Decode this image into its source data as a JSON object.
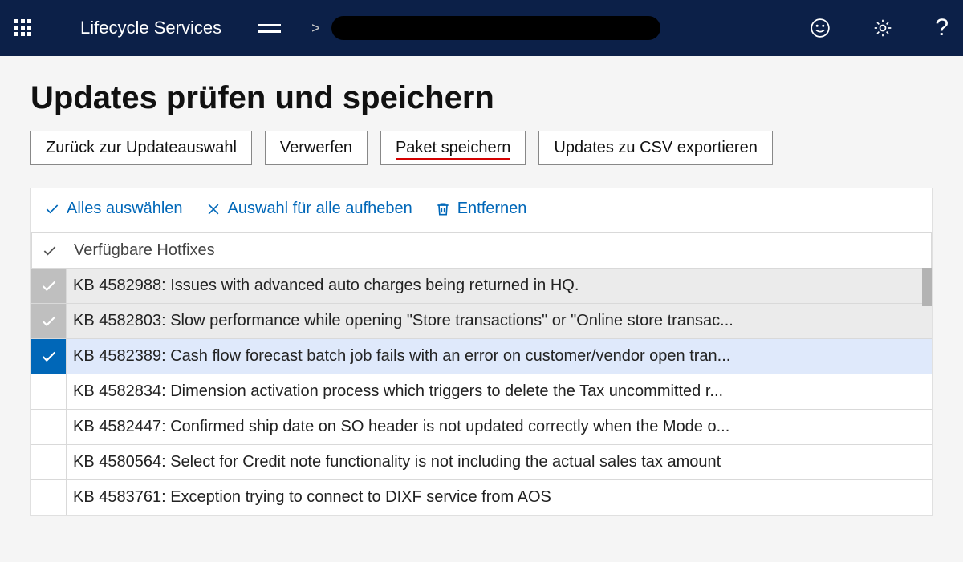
{
  "header": {
    "brand": "Lifecycle Services",
    "breadcrumb_chevron": ">"
  },
  "page": {
    "title": "Updates prüfen und speichern"
  },
  "buttons": {
    "back": "Zurück zur Updateauswahl",
    "discard": "Verwerfen",
    "save": "Paket speichern",
    "export": "Updates zu CSV exportieren"
  },
  "toolbar": {
    "select_all": "Alles auswählen",
    "deselect_all": "Auswahl für alle aufheben",
    "remove": "Entfernen"
  },
  "grid": {
    "header": "Verfügbare Hotfixes",
    "rows": [
      {
        "selected": true,
        "active": false,
        "text": "KB 4582988: Issues with advanced auto charges being returned in HQ."
      },
      {
        "selected": true,
        "active": false,
        "text": "KB 4582803: Slow performance while opening \"Store transactions\" or \"Online store transac..."
      },
      {
        "selected": true,
        "active": true,
        "text": "KB 4582389: Cash flow forecast batch job fails with an error on customer/vendor open tran..."
      },
      {
        "selected": false,
        "active": false,
        "text": "KB 4582834: Dimension activation process which triggers to delete the Tax uncommitted r..."
      },
      {
        "selected": false,
        "active": false,
        "text": "KB 4582447: Confirmed ship date on SO header is not updated correctly when the Mode o..."
      },
      {
        "selected": false,
        "active": false,
        "text": "KB 4580564: Select for Credit note functionality is not including the actual sales tax amount"
      },
      {
        "selected": false,
        "active": false,
        "text": "KB 4583761: Exception trying to connect to DIXF service from AOS"
      }
    ]
  }
}
